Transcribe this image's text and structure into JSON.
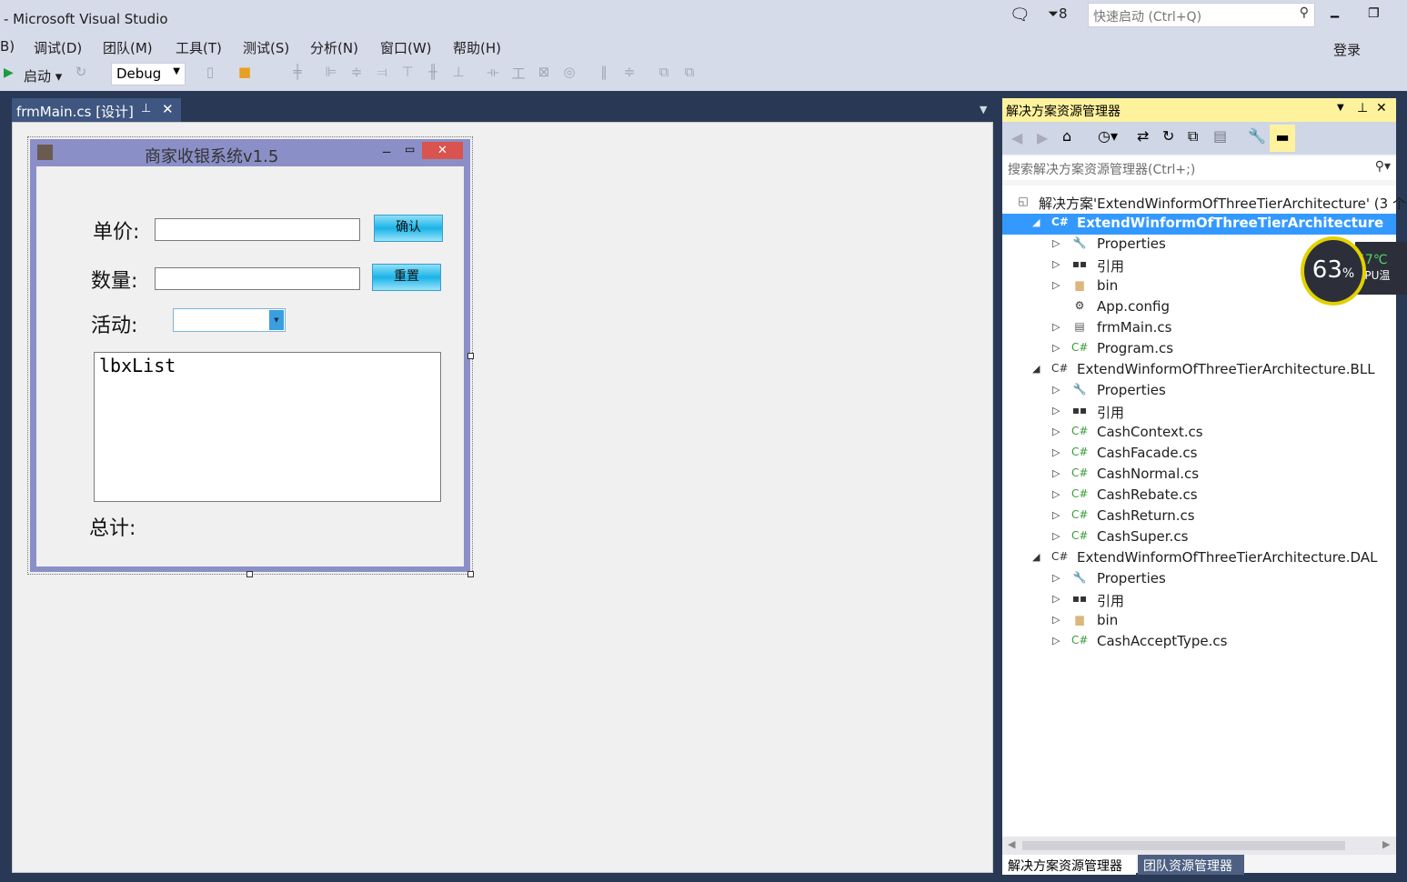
{
  "window": {
    "title": "- Microsoft Visual Studio",
    "notification_count": "8",
    "quick_launch_placeholder": "快速启动 (Ctrl+Q)",
    "login": "登录"
  },
  "menu": [
    "B)",
    "调试(D)",
    "团队(M)",
    "工具(T)",
    "测试(S)",
    "分析(N)",
    "窗口(W)",
    "帮助(H)"
  ],
  "toolbar": {
    "start": "启动",
    "config": "Debug"
  },
  "doc_tab": {
    "label": "frmMain.cs [设计]"
  },
  "form": {
    "title": "商家收银系统v1.5",
    "price_label": "单价:",
    "qty_label": "数量:",
    "activity_label": "活动:",
    "confirm_button": "确认",
    "reset_button": "重置",
    "listbox_name": "lbxList",
    "total_label": "总计:",
    "price_value": "",
    "qty_value": "",
    "activity_value": ""
  },
  "solution_explorer": {
    "title": "解决方案资源管理器",
    "search_placeholder": "搜索解决方案资源管理器(Ctrl+;)",
    "tree": [
      {
        "level": 0,
        "icon": "solution",
        "label": "解决方案'ExtendWinformOfThreeTierArchitecture' (3 个",
        "exp": ""
      },
      {
        "level": 1,
        "icon": "csproj",
        "label": "ExtendWinformOfThreeTierArchitecture",
        "exp": "◢",
        "selected": true
      },
      {
        "level": 2,
        "icon": "wrench",
        "label": "Properties",
        "exp": "▷"
      },
      {
        "level": 2,
        "icon": "references",
        "label": "引用",
        "exp": "▷"
      },
      {
        "level": 2,
        "icon": "folder",
        "label": "bin",
        "exp": "▷"
      },
      {
        "level": 2,
        "icon": "config",
        "label": "App.config",
        "exp": ""
      },
      {
        "level": 2,
        "icon": "form",
        "label": "frmMain.cs",
        "exp": "▷"
      },
      {
        "level": 2,
        "icon": "cs",
        "label": "Program.cs",
        "exp": "▷"
      },
      {
        "level": 1,
        "icon": "csproj",
        "label": "ExtendWinformOfThreeTierArchitecture.BLL",
        "exp": "◢"
      },
      {
        "level": 2,
        "icon": "wrench",
        "label": "Properties",
        "exp": "▷"
      },
      {
        "level": 2,
        "icon": "references",
        "label": "引用",
        "exp": "▷"
      },
      {
        "level": 2,
        "icon": "cs",
        "label": "CashContext.cs",
        "exp": "▷"
      },
      {
        "level": 2,
        "icon": "cs",
        "label": "CashFacade.cs",
        "exp": "▷"
      },
      {
        "level": 2,
        "icon": "cs",
        "label": "CashNormal.cs",
        "exp": "▷"
      },
      {
        "level": 2,
        "icon": "cs",
        "label": "CashRebate.cs",
        "exp": "▷"
      },
      {
        "level": 2,
        "icon": "cs",
        "label": "CashReturn.cs",
        "exp": "▷"
      },
      {
        "level": 2,
        "icon": "cs",
        "label": "CashSuper.cs",
        "exp": "▷"
      },
      {
        "level": 1,
        "icon": "csproj",
        "label": "ExtendWinformOfThreeTierArchitecture.DAL",
        "exp": "◢"
      },
      {
        "level": 2,
        "icon": "wrench",
        "label": "Properties",
        "exp": "▷"
      },
      {
        "level": 2,
        "icon": "references",
        "label": "引用",
        "exp": "▷"
      },
      {
        "level": 2,
        "icon": "folder",
        "label": "bin",
        "exp": "▷"
      },
      {
        "level": 2,
        "icon": "cs",
        "label": "CashAcceptType.cs",
        "exp": "▷"
      }
    ],
    "bottom_tabs": [
      "解决方案资源管理器",
      "团队资源管理器"
    ]
  },
  "cpu_widget": {
    "usage": "63",
    "unit": "%",
    "temp": "57℃",
    "label": "CPU温"
  },
  "colors": {
    "accent": "#3399ff",
    "chrome": "#d6dbe9",
    "dark": "#293955",
    "form_border": "#8b8fc7",
    "panel_header": "#fff29d"
  }
}
